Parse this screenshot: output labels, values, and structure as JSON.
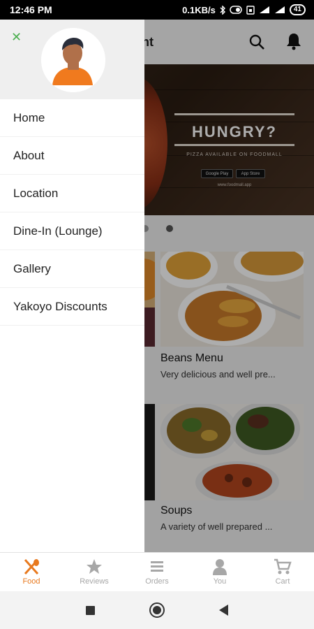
{
  "status_bar": {
    "time": "12:46 PM",
    "speed": "0.1KB/s",
    "battery": "41"
  },
  "header": {
    "title_partial": "nt"
  },
  "banner": {
    "title": "HUNGRY?",
    "subtitle": "PIZZA AVAILABLE ON FOODMALL",
    "store_google": "Google Play",
    "store_apple": "App Store",
    "url": "www.foodmall.app"
  },
  "cards": [
    {
      "title": "Beans Menu",
      "description": "Very delicious and well pre..."
    },
    {
      "title": "Soups",
      "description": "A variety of well prepared ..."
    }
  ],
  "drawer": {
    "menu": [
      {
        "label": "Home"
      },
      {
        "label": "About"
      },
      {
        "label": "Location"
      },
      {
        "label": "Dine-In (Lounge)"
      },
      {
        "label": "Gallery"
      },
      {
        "label": "Yakoyo Discounts"
      }
    ]
  },
  "tabs": [
    {
      "label": "Food",
      "icon": "fork-spoon-icon",
      "active": true
    },
    {
      "label": "Reviews",
      "icon": "star-icon",
      "active": false
    },
    {
      "label": "Orders",
      "icon": "list-icon",
      "active": false
    },
    {
      "label": "You",
      "icon": "person-icon",
      "active": false
    },
    {
      "label": "Cart",
      "icon": "cart-icon",
      "active": false
    }
  ],
  "colors": {
    "accent": "#e8791e",
    "close": "#4caf50",
    "avatar_shirt": "#f07a1e"
  }
}
